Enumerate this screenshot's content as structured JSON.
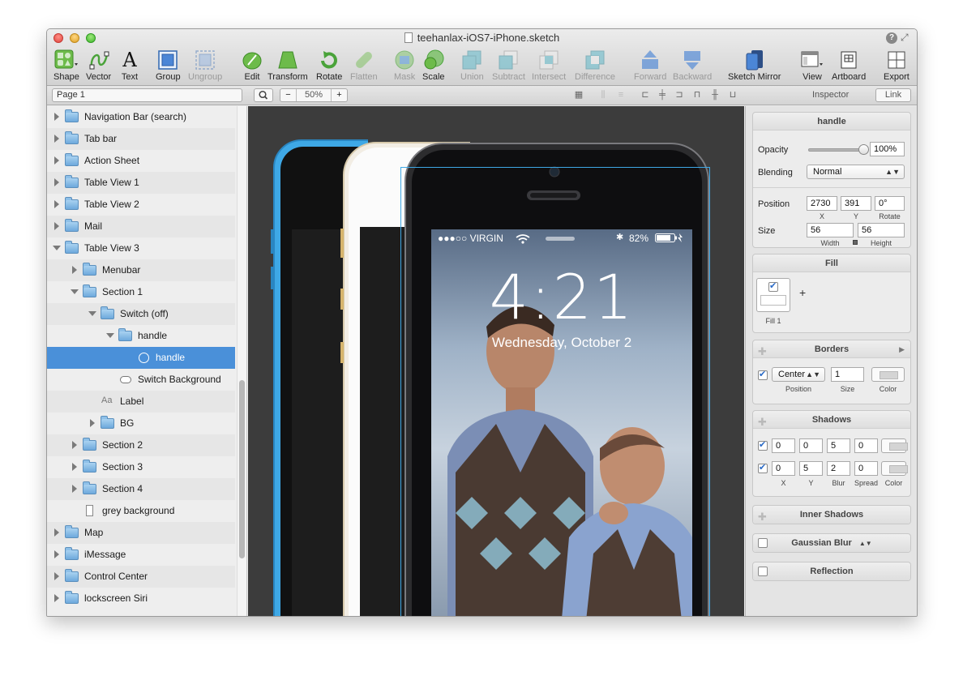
{
  "window": {
    "title": "teehanlax-iOS7-iPhone.sketch",
    "help_glyph": "?",
    "fullscreen_glyph": "⤢"
  },
  "toolbar": {
    "items": [
      {
        "label": "Shape"
      },
      {
        "label": "Vector"
      },
      {
        "label": "Text"
      },
      {
        "label": "Group"
      },
      {
        "label": "Ungroup"
      },
      {
        "label": "Edit"
      },
      {
        "label": "Transform"
      },
      {
        "label": "Rotate"
      },
      {
        "label": "Flatten"
      },
      {
        "label": "Mask"
      },
      {
        "label": "Scale"
      },
      {
        "label": "Union"
      },
      {
        "label": "Subtract"
      },
      {
        "label": "Intersect"
      },
      {
        "label": "Difference"
      },
      {
        "label": "Forward"
      },
      {
        "label": "Backward"
      },
      {
        "label": "Sketch Mirror"
      },
      {
        "label": "View"
      },
      {
        "label": "Artboard"
      },
      {
        "label": "Export"
      }
    ],
    "text_glyph": "A",
    "accent": "#3b87d4"
  },
  "subbar": {
    "page_select": "Page 1",
    "zoom_minus": "−",
    "zoom_value": "50%",
    "zoom_plus": "+",
    "inspector_label": "Inspector",
    "link_label": "Link"
  },
  "layers": {
    "rows": [
      {
        "label": "Navigation Bar (search)"
      },
      {
        "label": "Tab bar"
      },
      {
        "label": "Action Sheet"
      },
      {
        "label": "Table View 1"
      },
      {
        "label": "Table View 2"
      },
      {
        "label": "Mail"
      },
      {
        "label": "Table View 3"
      },
      {
        "label": "Menubar"
      },
      {
        "label": "Section 1"
      },
      {
        "label": "Switch (off)"
      },
      {
        "label": "handle"
      },
      {
        "label": "handle"
      },
      {
        "label": "Switch Background"
      },
      {
        "label": "Label",
        "glyph": "Aa"
      },
      {
        "label": "BG"
      },
      {
        "label": "Section 2"
      },
      {
        "label": "Section 3"
      },
      {
        "label": "Section 4"
      },
      {
        "label": "grey background"
      },
      {
        "label": "Map"
      },
      {
        "label": "iMessage"
      },
      {
        "label": "Control Center"
      },
      {
        "label": "lockscreen Siri"
      }
    ],
    "selected_color": "#4a90d9"
  },
  "lockscreen": {
    "carrier": "●●●○○ VIRGIN",
    "battery": "82%",
    "time": "4:21",
    "date": "Wednesday, October 2"
  },
  "inspector": {
    "title": "handle",
    "opacity_label": "Opacity",
    "opacity_value": "100%",
    "opacity_level": 1.0,
    "blending_label": "Blending",
    "blending_value": "Normal",
    "position_label": "Position",
    "position_x": "2730",
    "position_y": "391",
    "rotate": "0°",
    "x_label": "X",
    "y_label": "Y",
    "rotate_label": "Rotate",
    "size_label": "Size",
    "width": "56",
    "height": "56",
    "width_label": "Width",
    "height_label": "Height",
    "fill_title": "Fill",
    "fill_item_label": "Fill 1",
    "fill_add": "+",
    "borders_title": "Borders",
    "border_position": "Center",
    "border_size": "1",
    "border_position_label": "Position",
    "border_size_label": "Size",
    "border_color_label": "Color",
    "shadows_title": "Shadows",
    "shadows": [
      {
        "x": "0",
        "y": "0",
        "blur": "5",
        "spread": "0"
      },
      {
        "x": "0",
        "y": "5",
        "blur": "2",
        "spread": "0"
      }
    ],
    "shadow_x_label": "X",
    "shadow_y_label": "Y",
    "shadow_blur_label": "Blur",
    "shadow_spread_label": "Spread",
    "shadow_color_label": "Color",
    "inner_shadows_title": "Inner Shadows",
    "gaussian_blur_title": "Gaussian Blur",
    "reflection_title": "Reflection"
  }
}
